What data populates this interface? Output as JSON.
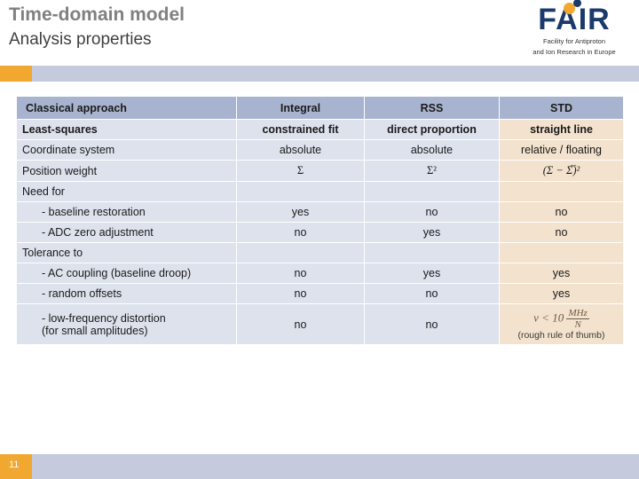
{
  "header": {
    "title_main": "Time-domain model",
    "title_sub": "Analysis properties",
    "logo": {
      "word": "FA IR",
      "word_text": "FAIR",
      "subtitle_line1": "Facility for Antiproton",
      "subtitle_line2": "and Ion Research in Europe"
    }
  },
  "table": {
    "columns": [
      "Classical approach",
      "Integral",
      "RSS",
      "STD"
    ],
    "rows": [
      {
        "label": "Least-squares",
        "bold": true,
        "cells": [
          "constrained fit",
          "direct proportion",
          "straight line"
        ]
      },
      {
        "label": "Coordinate system",
        "bold": false,
        "cells": [
          "absolute",
          "absolute",
          "relative / floating"
        ]
      },
      {
        "label": "Position weight",
        "bold": false,
        "cells": [
          "Σ",
          "Σ²",
          "(Σ − Σ̅)²"
        ]
      },
      {
        "label": "Need for",
        "bold": false,
        "cells": [
          "",
          "",
          ""
        ]
      },
      {
        "label": "- baseline restoration",
        "bold": false,
        "indent": true,
        "cells": [
          "yes",
          "no",
          "no"
        ]
      },
      {
        "label": "- ADC zero adjustment",
        "bold": false,
        "indent": true,
        "cells": [
          "no",
          "yes",
          "no"
        ]
      },
      {
        "label": "Tolerance to",
        "bold": false,
        "cells": [
          "",
          "",
          ""
        ]
      },
      {
        "label": "- AC coupling (baseline droop)",
        "bold": false,
        "indent": true,
        "cells": [
          "no",
          "yes",
          "yes"
        ]
      },
      {
        "label": "- random offsets",
        "bold": false,
        "indent": true,
        "cells": [
          "no",
          "no",
          "yes"
        ]
      },
      {
        "label": "- low-frequency distortion (for small amplitudes)",
        "label_line1": "- low-frequency distortion",
        "label_line2": "(for small amplitudes)",
        "bold": false,
        "indent": true,
        "cells": [
          "no",
          "no",
          "formula"
        ]
      }
    ],
    "formula_cell": {
      "expression": "v < 10 MHz / N",
      "note": "(rough rule of thumb)"
    }
  },
  "footer": {
    "page_number": "11"
  },
  "colors": {
    "accent_orange": "#f0a830",
    "band_blue": "#c5cbdc",
    "header_cell": "#a8b4cf",
    "body_cell": "#dde2ed",
    "highlight_cell": "#f3e2cd",
    "title_gray": "#808080",
    "logo_navy": "#1b3a6b"
  }
}
